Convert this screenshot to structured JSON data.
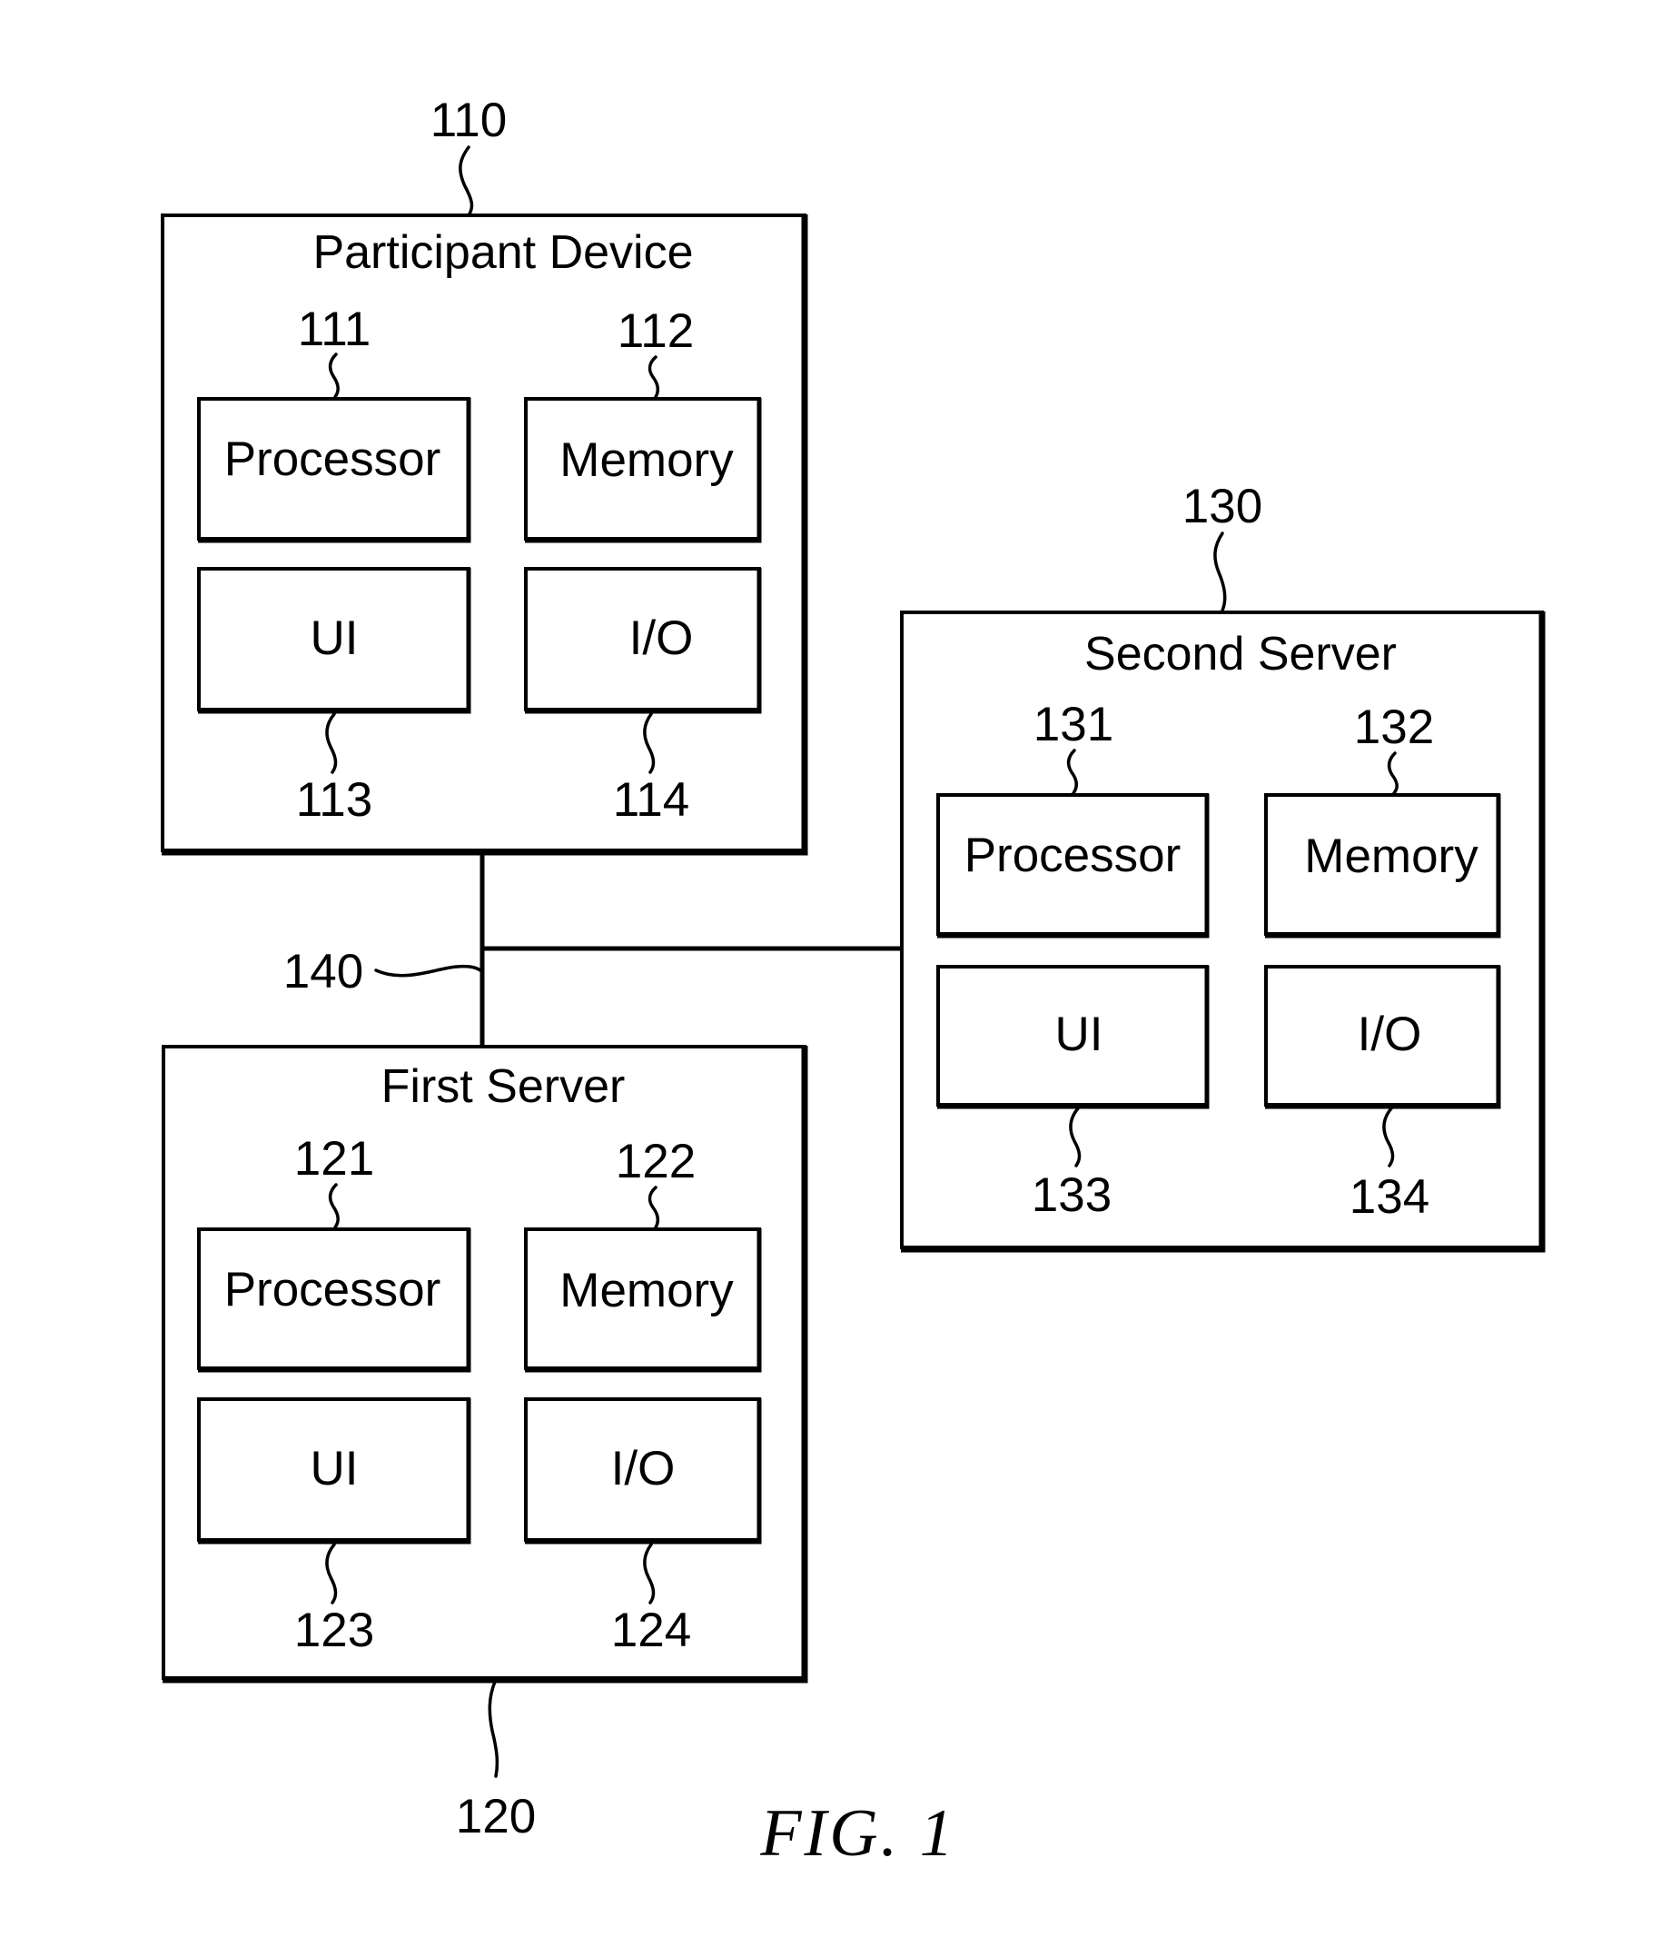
{
  "figure": {
    "caption": "FIG. 1",
    "network": {
      "ref": "140"
    },
    "participant_device": {
      "ref": "110",
      "title": "Participant Device",
      "components": {
        "processor": {
          "label": "Processor",
          "ref": "111"
        },
        "memory": {
          "label": "Memory",
          "ref": "112"
        },
        "ui": {
          "label": "UI",
          "ref": "113"
        },
        "io": {
          "label": "I/O",
          "ref": "114"
        }
      }
    },
    "first_server": {
      "ref": "120",
      "title": "First Server",
      "components": {
        "processor": {
          "label": "Processor",
          "ref": "121"
        },
        "memory": {
          "label": "Memory",
          "ref": "122"
        },
        "ui": {
          "label": "UI",
          "ref": "123"
        },
        "io": {
          "label": "I/O",
          "ref": "124"
        }
      }
    },
    "second_server": {
      "ref": "130",
      "title": "Second Server",
      "components": {
        "processor": {
          "label": "Processor",
          "ref": "131"
        },
        "memory": {
          "label": "Memory",
          "ref": "132"
        },
        "ui": {
          "label": "UI",
          "ref": "133"
        },
        "io": {
          "label": "I/O",
          "ref": "134"
        }
      }
    },
    "connections": [
      {
        "from": "110",
        "to": "120",
        "via": "140"
      },
      {
        "from": "140",
        "to": "130"
      }
    ]
  }
}
